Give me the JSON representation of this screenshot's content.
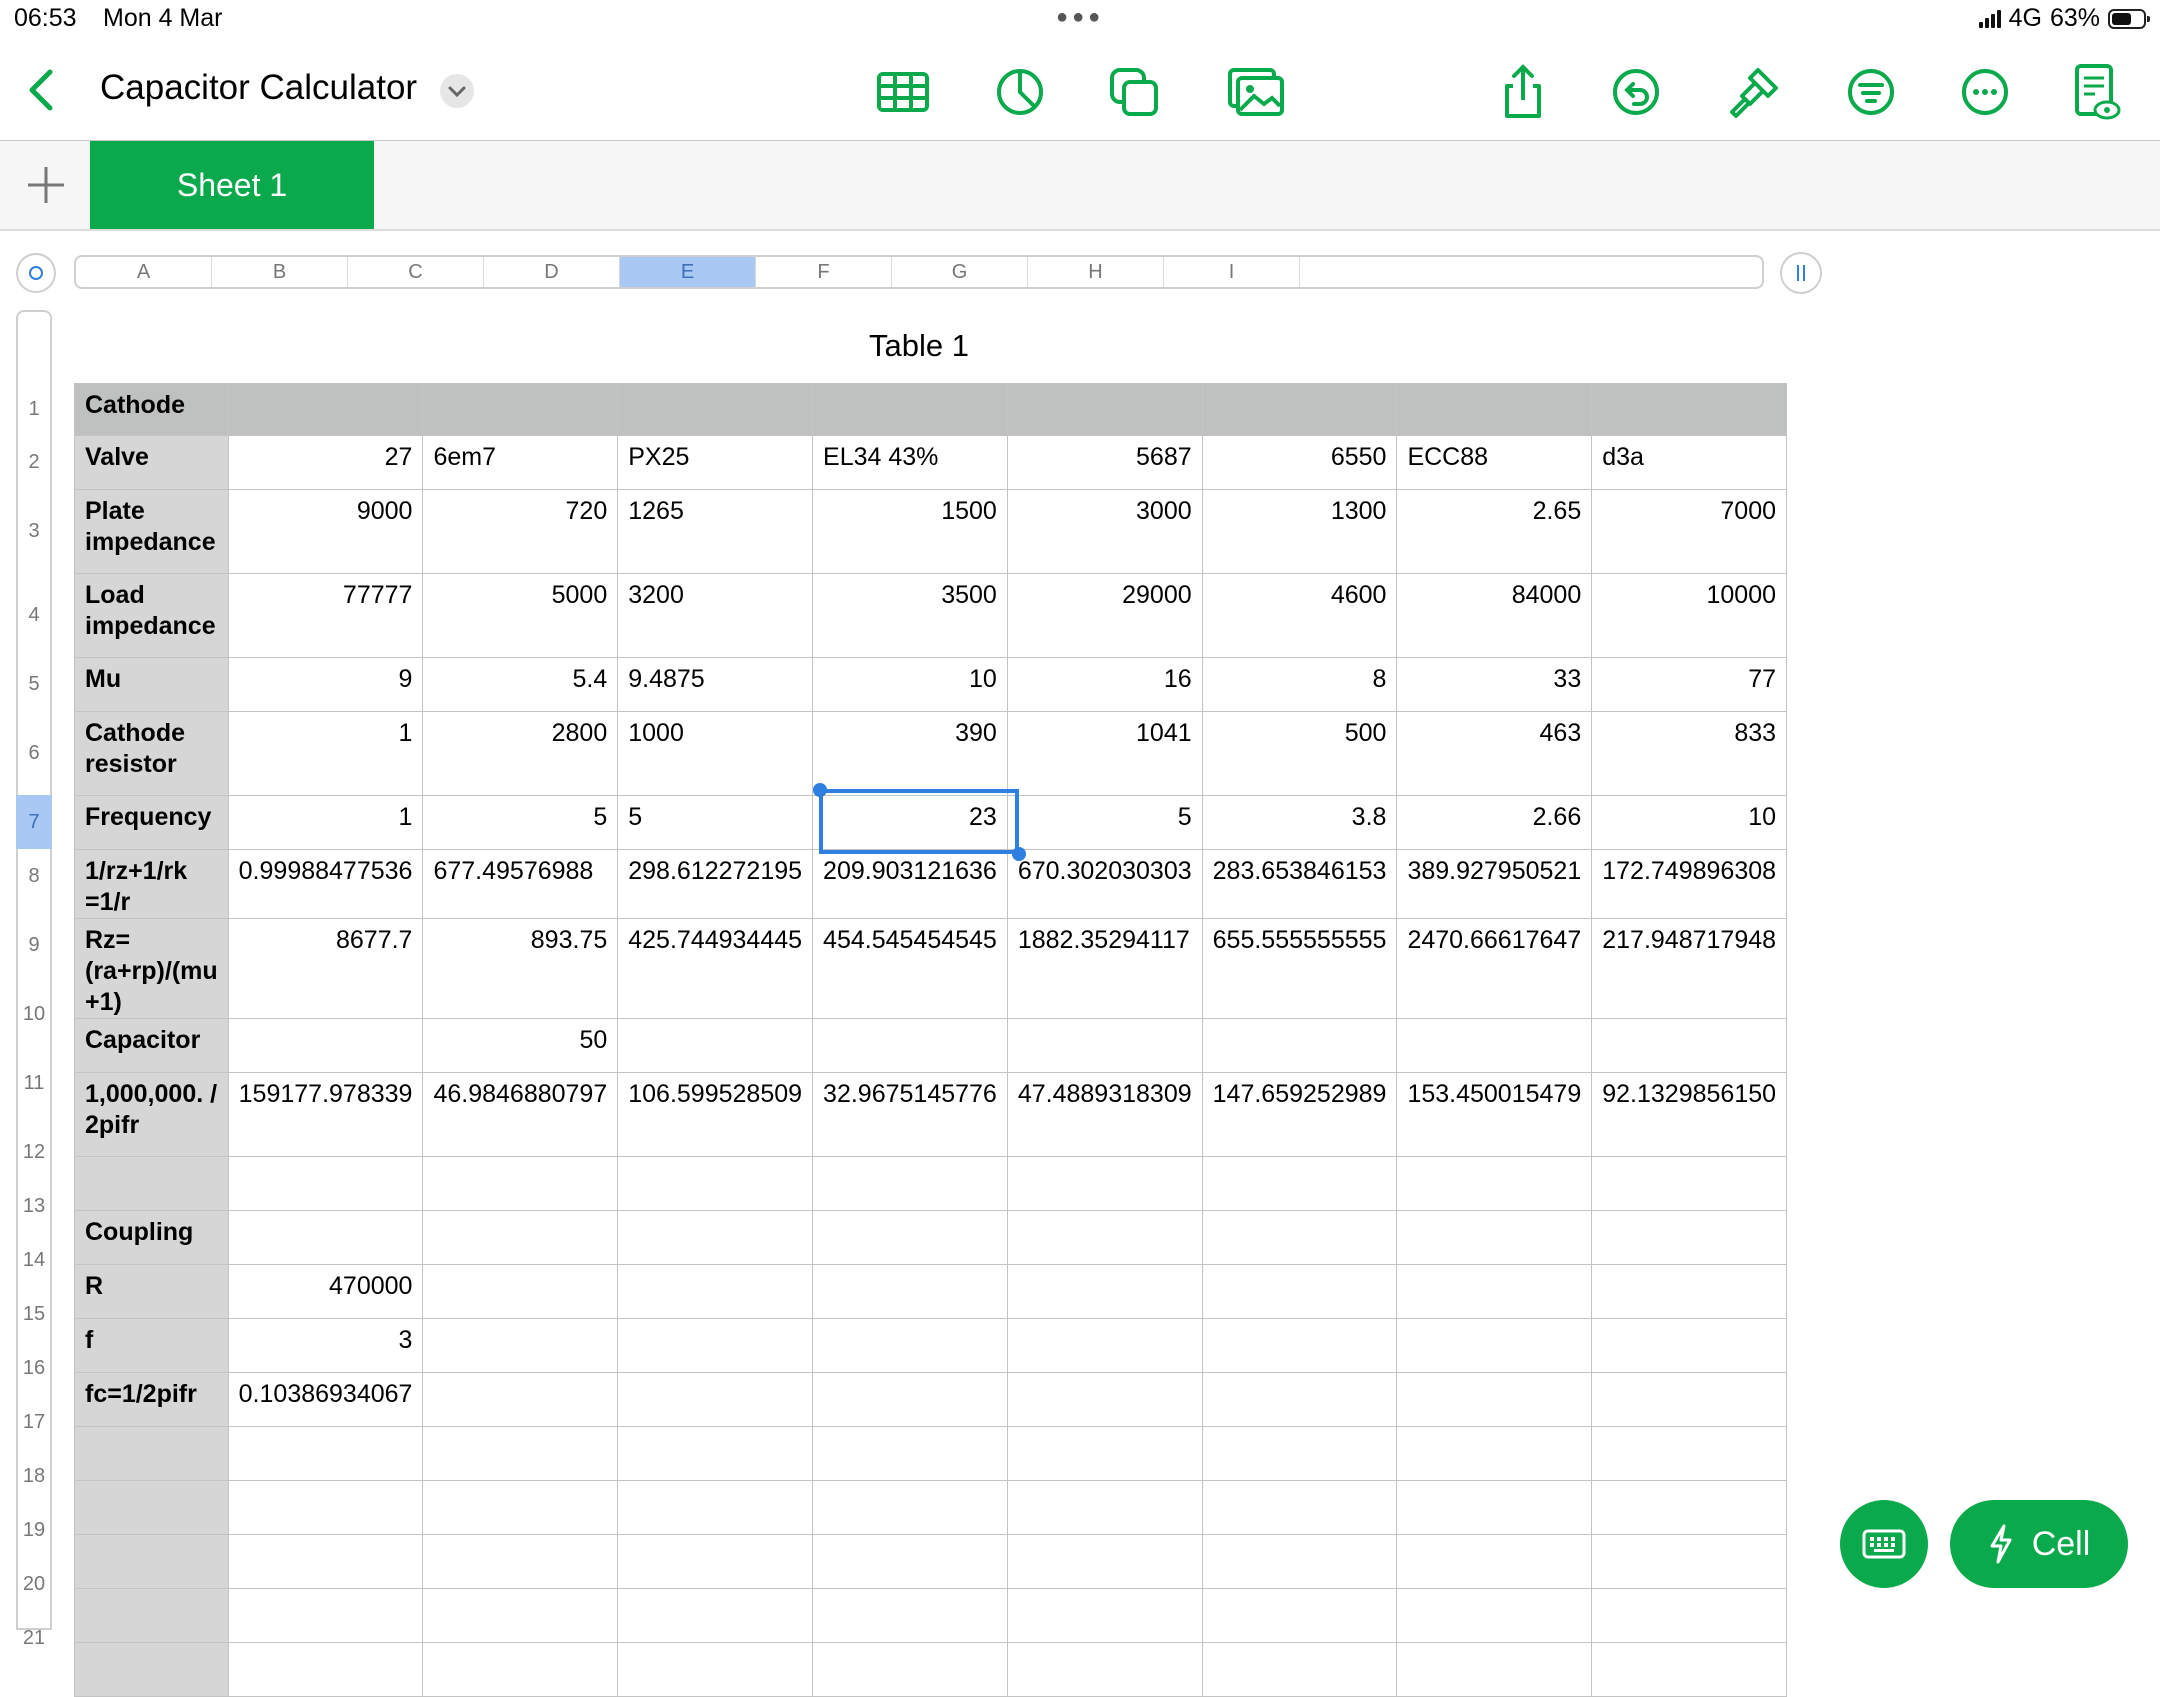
{
  "status_bar": {
    "time": "06:53",
    "date": "Mon 4 Mar",
    "network": "4G",
    "battery": "63%",
    "battery_level": 0.63
  },
  "toolbar": {
    "title": "Capacitor Calculator",
    "icons": [
      "table-icon",
      "chart-icon",
      "shapes-icon",
      "media-icon",
      "share-icon",
      "undo-icon",
      "format-brush-icon",
      "organize-icon",
      "more-icon",
      "reading-view-icon"
    ]
  },
  "sheet_tabs": {
    "active": "Sheet 1"
  },
  "columns": [
    "A",
    "B",
    "C",
    "D",
    "E",
    "F",
    "G",
    "H",
    "I"
  ],
  "selected_column": "E",
  "selected_row": "7",
  "row_numbers": [
    "1",
    "2",
    "3",
    "4",
    "5",
    "6",
    "7",
    "8",
    "9",
    "10",
    "11",
    "12",
    "13",
    "14",
    "15",
    "16",
    "17",
    "18",
    "19",
    "20",
    "21"
  ],
  "table": {
    "title": "Table 1",
    "rows": [
      [
        "Cathode",
        "",
        "",
        "",
        "",
        "",
        "",
        "",
        ""
      ],
      [
        "Valve",
        "27",
        "6em7",
        "PX25",
        "EL34 43%",
        "5687",
        "6550",
        "ECC88",
        "d3a"
      ],
      [
        "Plate impedance",
        "9000",
        "720",
        "1265",
        "1500",
        "3000",
        "1300",
        "2.65",
        "7000"
      ],
      [
        "Load impedance",
        "77777",
        "5000",
        "3200",
        "3500",
        "29000",
        "4600",
        "84000",
        "10000"
      ],
      [
        "Mu",
        "9",
        "5.4",
        "9.4875",
        "10",
        "16",
        "8",
        "33",
        "77"
      ],
      [
        "Cathode resistor",
        "1",
        "2800",
        "1000",
        "390",
        "1041",
        "500",
        "463",
        "833"
      ],
      [
        "Frequency",
        "1",
        "5",
        "5",
        "23",
        "5",
        "3.8",
        "2.66",
        "10"
      ],
      [
        "1/rz+1/rk =1/r",
        "0.99988477536",
        "677.49576988",
        "298.612272195",
        "209.903121636",
        "670.302030303",
        "283.653846153",
        "389.927950521",
        "172.749896308"
      ],
      [
        "Rz=(ra+rp)/(mu +1)",
        "8677.7",
        "893.75",
        "425.744934445",
        "454.545454545",
        "1882.35294117",
        "655.555555555",
        "2470.66617647",
        "217.948717948"
      ],
      [
        "Capacitor",
        "",
        "50",
        "",
        "",
        "",
        "",
        "",
        ""
      ],
      [
        "1,000,000.  / 2pifr",
        "159177.978339",
        "46.9846880797",
        "106.599528509",
        "32.9675145776",
        "47.4889318309",
        "147.659252989",
        "153.450015479",
        "92.1329856150"
      ],
      [
        "",
        "",
        "",
        "",
        "",
        "",
        "",
        "",
        ""
      ],
      [
        "Coupling",
        "",
        "",
        "",
        "",
        "",
        "",
        "",
        ""
      ],
      [
        "R",
        "470000",
        "",
        "",
        "",
        "",
        "",
        "",
        ""
      ],
      [
        "f",
        "3",
        "",
        "",
        "",
        "",
        "",
        "",
        ""
      ],
      [
        "fc=1/2pifr",
        "0.10386934067",
        "",
        "",
        "",
        "",
        "",
        "",
        ""
      ],
      [
        "",
        "",
        "",
        "",
        "",
        "",
        "",
        "",
        ""
      ],
      [
        "",
        "",
        "",
        "",
        "",
        "",
        "",
        "",
        ""
      ],
      [
        "",
        "",
        "",
        "",
        "",
        "",
        "",
        "",
        ""
      ],
      [
        "",
        "",
        "",
        "",
        "",
        "",
        "",
        "",
        ""
      ],
      [
        "",
        "",
        "",
        "",
        "",
        "",
        "",
        "",
        ""
      ]
    ],
    "align": [
      [
        "l",
        "l",
        "l",
        "l",
        "l",
        "l",
        "l",
        "l",
        "l"
      ],
      [
        "l",
        "r",
        "l",
        "l",
        "l",
        "r",
        "r",
        "l",
        "l"
      ],
      [
        "l",
        "r",
        "r",
        "l",
        "r",
        "r",
        "r",
        "r",
        "r"
      ],
      [
        "l",
        "r",
        "r",
        "l",
        "r",
        "r",
        "r",
        "r",
        "r"
      ],
      [
        "l",
        "r",
        "r",
        "l",
        "r",
        "r",
        "r",
        "r",
        "r"
      ],
      [
        "l",
        "r",
        "r",
        "l",
        "r",
        "r",
        "r",
        "r",
        "r"
      ],
      [
        "l",
        "r",
        "r",
        "l",
        "r",
        "r",
        "r",
        "r",
        "r"
      ],
      [
        "l",
        "l",
        "l",
        "l",
        "l",
        "l",
        "l",
        "l",
        "l"
      ],
      [
        "l",
        "r",
        "r",
        "l",
        "l",
        "l",
        "l",
        "l",
        "l"
      ],
      [
        "l",
        "r",
        "r",
        "l",
        "l",
        "l",
        "l",
        "l",
        "l"
      ],
      [
        "l",
        "l",
        "l",
        "l",
        "l",
        "l",
        "l",
        "l",
        "l"
      ],
      [
        "l",
        "l",
        "l",
        "l",
        "l",
        "l",
        "l",
        "l",
        "l"
      ],
      [
        "l",
        "l",
        "l",
        "l",
        "l",
        "l",
        "l",
        "l",
        "l"
      ],
      [
        "l",
        "r",
        "l",
        "l",
        "l",
        "l",
        "l",
        "l",
        "l"
      ],
      [
        "l",
        "r",
        "l",
        "l",
        "l",
        "l",
        "l",
        "l",
        "l"
      ],
      [
        "l",
        "l",
        "l",
        "l",
        "l",
        "l",
        "l",
        "l",
        "l"
      ],
      [
        "l",
        "l",
        "l",
        "l",
        "l",
        "l",
        "l",
        "l",
        "l"
      ],
      [
        "l",
        "l",
        "l",
        "l",
        "l",
        "l",
        "l",
        "l",
        "l"
      ],
      [
        "l",
        "l",
        "l",
        "l",
        "l",
        "l",
        "l",
        "l",
        "l"
      ],
      [
        "l",
        "l",
        "l",
        "l",
        "l",
        "l",
        "l",
        "l",
        "l"
      ],
      [
        "l",
        "l",
        "l",
        "l",
        "l",
        "l",
        "l",
        "l",
        "l"
      ]
    ]
  },
  "floating": {
    "cell_label": "Cell"
  },
  "colors": {
    "accent": "#0aa94b",
    "selection": "#2f7fe0",
    "header_fill": "#bfc1c0",
    "label_fill": "#d6d6d6"
  }
}
